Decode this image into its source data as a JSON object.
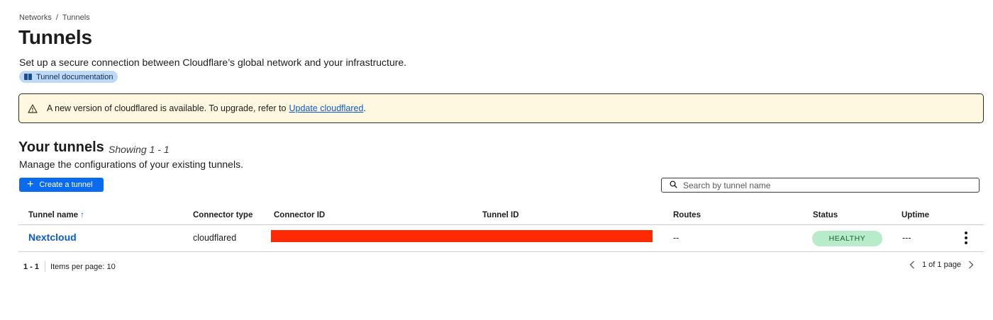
{
  "breadcrumb": {
    "items": [
      "Networks",
      "Tunnels"
    ],
    "separator": "/"
  },
  "page": {
    "title": "Tunnels",
    "description": "Set up a secure connection between Cloudflare’s global network and your infrastructure.",
    "doc_link": "Tunnel documentation"
  },
  "alert": {
    "icon": "warning-triangle-icon",
    "text": "A new version of cloudflared is available. To upgrade, refer to",
    "link": "Update cloudflared",
    "suffix": "."
  },
  "section": {
    "title": "Your tunnels",
    "showing": "Showing 1 - 1",
    "description": "Manage the configurations of your existing tunnels."
  },
  "toolbar": {
    "create_label": "Create a tunnel",
    "search_placeholder": "Search by tunnel name"
  },
  "table": {
    "columns": {
      "name": "Tunnel name",
      "connector_type": "Connector type",
      "connector_id": "Connector ID",
      "tunnel_id": "Tunnel ID",
      "routes": "Routes",
      "status": "Status",
      "uptime": "Uptime"
    },
    "sort_icon": "arrow-up-icon",
    "rows": [
      {
        "name": "Nextcloud",
        "connector_type": "cloudflared",
        "routes": "--",
        "status": "HEALTHY",
        "uptime": "---"
      }
    ]
  },
  "pagination": {
    "range": "1 - 1",
    "per_page": "Items per page: 10",
    "page_info": "1 of 1 page"
  },
  "colors": {
    "primary": "#0b6bef",
    "link": "#0b5ad1",
    "alert_bg": "#fff8e1",
    "healthy_bg": "#b7ebc9",
    "redaction": "#ff2a00"
  }
}
